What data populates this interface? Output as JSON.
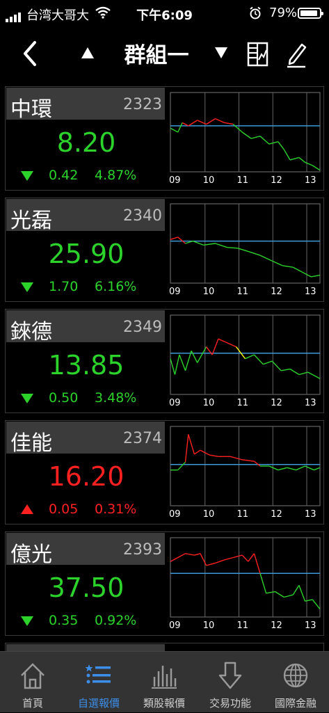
{
  "status_bar": {
    "carrier": "台湾大哥大",
    "time": "下午6:09",
    "battery": "79%"
  },
  "nav": {
    "title": "群組一"
  },
  "stocks": [
    {
      "name": "中環",
      "code": "2323",
      "price": "8.20",
      "direction": "down",
      "change": "0.42",
      "percent": "4.87%"
    },
    {
      "name": "光磊",
      "code": "2340",
      "price": "25.90",
      "direction": "down",
      "change": "1.70",
      "percent": "6.16%"
    },
    {
      "name": "錸德",
      "code": "2349",
      "price": "13.85",
      "direction": "down",
      "change": "0.50",
      "percent": "3.48%"
    },
    {
      "name": "佳能",
      "code": "2374",
      "price": "16.20",
      "direction": "up",
      "change": "0.05",
      "percent": "0.31%"
    },
    {
      "name": "億光",
      "code": "2393",
      "price": "37.50",
      "direction": "down",
      "change": "0.35",
      "percent": "0.92%"
    }
  ],
  "chart_axis": {
    "x_ticks": [
      "09",
      "10",
      "11",
      "12",
      "13"
    ]
  },
  "tabs": [
    {
      "label": "首頁",
      "icon": "home-icon"
    },
    {
      "label": "自選報價",
      "icon": "watchlist-icon"
    },
    {
      "label": "類股報價",
      "icon": "bar-chart-icon"
    },
    {
      "label": "交易功能",
      "icon": "trade-arrow-icon"
    },
    {
      "label": "國際金融",
      "icon": "globe-icon"
    }
  ],
  "colors": {
    "up": "#ff2020",
    "down": "#2bd32b",
    "flat": "#ffff00",
    "reference_line": "#3d9ad6",
    "active_tab": "#3d8ee8"
  }
}
